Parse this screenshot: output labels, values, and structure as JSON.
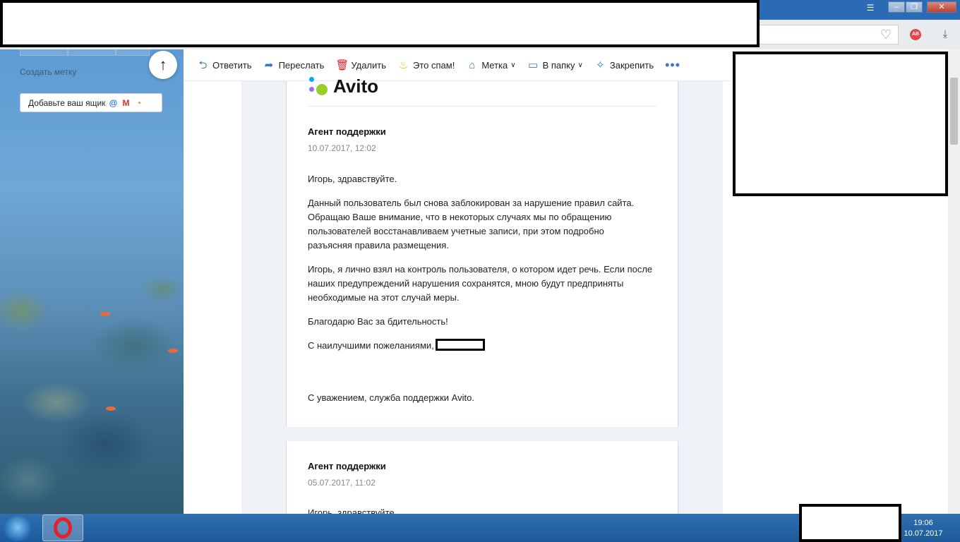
{
  "toolbar": {
    "reply": "Ответить",
    "forward": "Переслать",
    "delete": "Удалить",
    "spam": "Это спам!",
    "label": "Метка",
    "folder": "В папку",
    "pin": "Закрепить",
    "more": "•••"
  },
  "sidebar": {
    "create_label": "Создать метку",
    "add_mailbox": "Добавьте ваш ящик"
  },
  "letter": {
    "logo_text": "Avito",
    "sender": "Агент поддержки",
    "date": "10.07.2017, 12:02",
    "greeting": "Игорь, здравствуйте.",
    "p1": "Данный пользователь был снова заблокирован за нарушение правил сайта. Обращаю Ваше внимание, что в некоторых случаях мы по обращению пользователей восстанавливаем учетные записи, при этом подробно разъясняя правила размещения.",
    "p2": "Игорь, я лично взял на контроль пользователя, о котором идет речь. Если после наших предупреждений нарушения сохранятся, мною будут предприняты необходимые на этот случай меры.",
    "p3": "Благодарю Вас за бдительность!",
    "p4": "С наилучшими пожеланиями,",
    "signoff": "С уважением, служба поддержки Avito."
  },
  "letter2": {
    "sender": "Агент поддержки",
    "date": "05.07.2017, 11:02",
    "greeting": "Игорь, здравствуйте."
  },
  "taskbar": {
    "time": "19:06",
    "date": "10.07.2017"
  },
  "colors": {
    "accent": "#3a76c4",
    "delete_red": "#d8232a",
    "avito_green": "#97cf26",
    "avito_purple": "#a169f7",
    "avito_blue": "#00aaff",
    "avito_red": "#ff4053"
  }
}
